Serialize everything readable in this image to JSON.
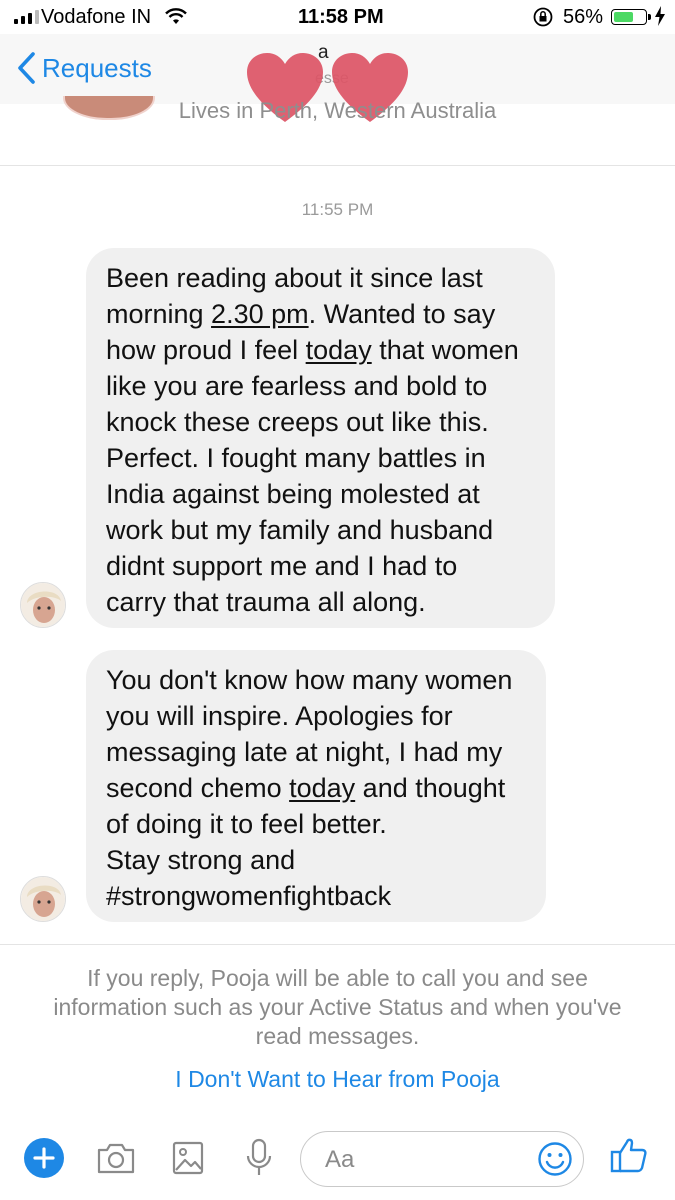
{
  "status_bar": {
    "carrier": "Vodafone IN",
    "time": "11:58 PM",
    "battery_percent": "56%",
    "battery_level": 0.56,
    "icons": [
      "signal-icon",
      "wifi-icon",
      "rotation-lock-icon",
      "battery-icon",
      "charging-icon"
    ]
  },
  "nav": {
    "back_label": "Requests",
    "name_fragment": "a",
    "subtitle_fragment": "esse"
  },
  "profile": {
    "lives_text": "Lives in Perth, Western Australia"
  },
  "thread": {
    "timestamp": "11:55 PM",
    "messages": [
      {
        "lines": [
          "Been reading about it since last",
          "morning 2.30 pm. Wanted to say",
          "how proud I feel today that women",
          "like you are fearless and bold to",
          "knock these creeps out like this.",
          "Perfect. I fought many battles in",
          "India against being molested at",
          "work but my family and husband",
          "didnt support me and I had to",
          "carry that trauma all along."
        ],
        "links": [
          "2.30 pm",
          "today"
        ]
      },
      {
        "lines": [
          "You don't know how many women",
          "you will inspire. Apologies for",
          "messaging late at night, I had my",
          "second chemo today and thought",
          "of doing it to feel better.",
          "Stay strong and",
          "#strongwomenfightback"
        ],
        "links": [
          "today"
        ]
      }
    ]
  },
  "request_notice": {
    "text": "If you reply, Pooja will be able to call you and see information such as your Active Status and when you've read messages.",
    "ignore_link": "I Don't Want to Hear from Pooja"
  },
  "composer": {
    "placeholder": "Aa",
    "accent": "#1e88e5"
  }
}
